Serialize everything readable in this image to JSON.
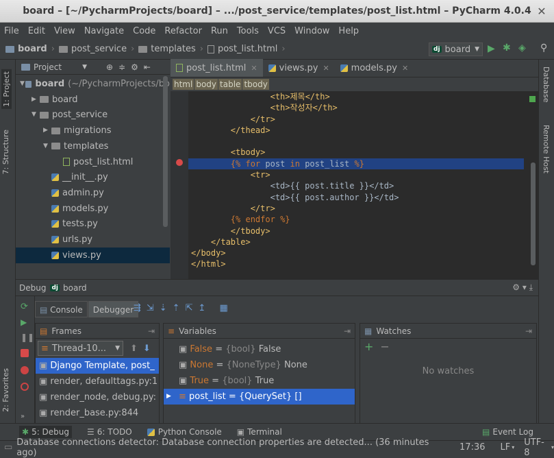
{
  "window": {
    "title": "board – [~/PycharmProjects/board] – .../post_service/templates/post_list.html – PyCharm 4.0.4"
  },
  "menu": [
    "File",
    "Edit",
    "View",
    "Navigate",
    "Code",
    "Refactor",
    "Run",
    "Tools",
    "VCS",
    "Window",
    "Help"
  ],
  "breadcrumb": [
    "board",
    "post_service",
    "templates",
    "post_list.html"
  ],
  "run_config": {
    "label": "board",
    "badge": "dj"
  },
  "left_strip": {
    "project": "1: Project",
    "structure": "7: Structure",
    "favorites": "2: Favorites"
  },
  "right_strip": {
    "database": "Database",
    "remote": "Remote Host"
  },
  "project_panel": {
    "title": "Project",
    "tree": [
      {
        "label": "board",
        "suffix": "(~/PycharmProjects/bo",
        "kind": "root"
      },
      {
        "label": "board",
        "kind": "folder"
      },
      {
        "label": "post_service",
        "kind": "folder"
      },
      {
        "label": "migrations",
        "kind": "folder"
      },
      {
        "label": "templates",
        "kind": "folder"
      },
      {
        "label": "post_list.html",
        "kind": "html"
      },
      {
        "label": "__init__.py",
        "kind": "py"
      },
      {
        "label": "admin.py",
        "kind": "py"
      },
      {
        "label": "models.py",
        "kind": "py"
      },
      {
        "label": "tests.py",
        "kind": "py"
      },
      {
        "label": "urls.py",
        "kind": "py"
      },
      {
        "label": "views.py",
        "kind": "py"
      }
    ]
  },
  "editor": {
    "tabs": [
      "post_list.html",
      "views.py",
      "models.py"
    ],
    "html_breadcrumb": [
      "html",
      "body",
      "table",
      "tbody"
    ],
    "code": [
      "                <th>제목</th>",
      "                <th>작성자</th>",
      "            </tr>",
      "        </thead>",
      "",
      "        <tbody>",
      "        {% for post in post_list %}",
      "            <tr>",
      "                <td>{{ post.title }}</td>",
      "                <td>{{ post.author }}</td>",
      "            </tr>",
      "        {% endfor %}",
      "        </tbody>",
      "    </table>",
      "</body>",
      "</html>"
    ]
  },
  "debug": {
    "header": "Debug",
    "config": "board",
    "tabs": [
      "Console",
      "Debugger"
    ],
    "frames_title": "Frames",
    "thread": "Thread-10...",
    "frames": [
      "Django Template, post_",
      "render, defaulttags.py:1",
      "render_node, debug.py:",
      "render_base.py:844"
    ],
    "variables_title": "Variables",
    "variables": [
      {
        "name": "False",
        "type": "{bool}",
        "value": "False"
      },
      {
        "name": "None",
        "type": "{NoneType}",
        "value": "None"
      },
      {
        "name": "True",
        "type": "{bool}",
        "value": "True"
      },
      {
        "name": "post_list",
        "type": "{QuerySet}",
        "value": "[]"
      }
    ],
    "watches_title": "Watches",
    "no_watches": "No watches"
  },
  "bottom_tabs": [
    "5: Debug",
    "6: TODO",
    "Python Console",
    "Terminal"
  ],
  "event_log": "Event Log",
  "status": {
    "message": "Database connections detector: Database connection properties are detected... (36 minutes ago)",
    "position": "17:36",
    "line_sep": "LF",
    "encoding": "UTF-8"
  }
}
